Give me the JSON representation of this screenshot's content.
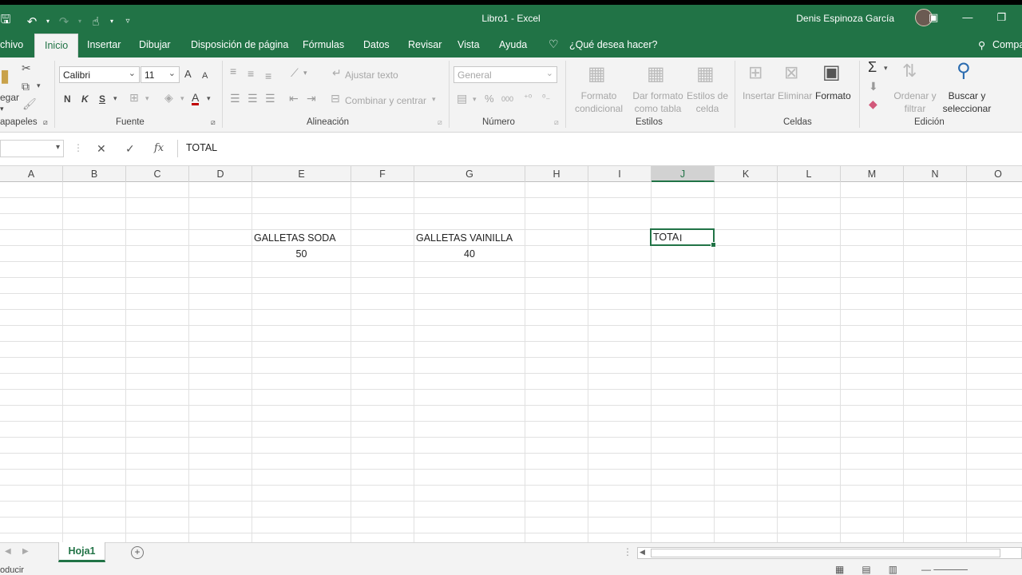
{
  "window": {
    "title": "Libro1  -  Excel",
    "user": "Denis Espinoza García",
    "qat_icons": [
      "save-icon",
      "undo-icon",
      "redo-icon",
      "touch-mode-icon",
      "customize-qat-icon"
    ]
  },
  "tabs": [
    "chivo",
    "Inicio",
    "Insertar",
    "Dibujar",
    "Disposición de página",
    "Fórmulas",
    "Datos",
    "Revisar",
    "Vista",
    "Ayuda"
  ],
  "active_tab": "Inicio",
  "tell_me": "¿Qué desea hacer?",
  "share": "Compa",
  "ribbon": {
    "clipboard": {
      "paste_label": "egar",
      "group_label": "apapeles"
    },
    "font": {
      "family": "Calibri",
      "size": "11",
      "bold": "N",
      "italic": "K",
      "underline": "S",
      "grow": "A",
      "shrink": "A",
      "color_letter": "A",
      "font_color": "#c00000",
      "group_label": "Fuente"
    },
    "alignment": {
      "wrap": "Ajustar texto",
      "merge": "Combinar y centrar",
      "group_label": "Alineación"
    },
    "number": {
      "format": "General",
      "percent": "%",
      "thousands": "000",
      "group_label": "Número"
    },
    "styles": {
      "conditional_l1": "Formato",
      "conditional_l2": "condicional",
      "table_l1": "Dar formato",
      "table_l2": "como tabla",
      "cell_l1": "Estilos de",
      "cell_l2": "celda",
      "group_label": "Estilos"
    },
    "cells": {
      "insert": "Insertar",
      "delete": "Eliminar",
      "format": "Formato",
      "group_label": "Celdas"
    },
    "editing": {
      "sort_l1": "Ordenar y",
      "sort_l2": "filtrar",
      "find_l1": "Buscar y",
      "find_l2": "seleccionar",
      "group_label": "Edición"
    }
  },
  "formula_bar": {
    "name_box": "",
    "cancel": "✕",
    "enter": "✓",
    "fx": "fx",
    "content": "TOTAL"
  },
  "columns": [
    "A",
    "B",
    "C",
    "D",
    "E",
    "F",
    "G",
    "H",
    "I",
    "J",
    "K",
    "L",
    "M",
    "N",
    "O"
  ],
  "selected_column": "J",
  "cells": {
    "E4": "GALLETAS SODA",
    "G4": "GALLETAS VAINILLA",
    "J4": "TOTA",
    "E5": "50",
    "G5": "40"
  },
  "sheets": [
    "Hoja1"
  ],
  "status": {
    "mode": "oducir"
  },
  "accent_color": "#217346"
}
